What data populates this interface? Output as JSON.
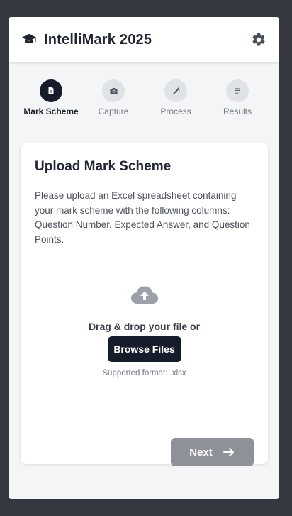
{
  "header": {
    "title": "IntelliMark 2025",
    "brand_icon": "graduation-cap-icon",
    "settings_icon": "gear-icon"
  },
  "steps": [
    {
      "label": "Mark Scheme",
      "icon": "document-icon",
      "active": true
    },
    {
      "label": "Capture",
      "icon": "camera-icon",
      "active": false
    },
    {
      "label": "Process",
      "icon": "magic-wand-icon",
      "active": false
    },
    {
      "label": "Results",
      "icon": "list-icon",
      "active": false
    }
  ],
  "card": {
    "title": "Upload Mark Scheme",
    "description": "Please upload an Excel spreadsheet containing your mark scheme with the following columns: Question Number, Expected Answer, and Question Points.",
    "upload_icon": "cloud-upload-icon",
    "drag_text": "Drag & drop your file or",
    "browse_label": "Browse Files",
    "supported_format": "Supported format: .xlsx",
    "next_label": "Next",
    "next_icon": "arrow-right-icon"
  },
  "colors": {
    "page_background": "#353840",
    "panel_background": "#f4f5f7",
    "accent_dark": "#171c2b",
    "inactive_step": "#dfe2e6",
    "next_button_disabled": "#8e9198",
    "upload_icon": "#9ca1a9"
  }
}
